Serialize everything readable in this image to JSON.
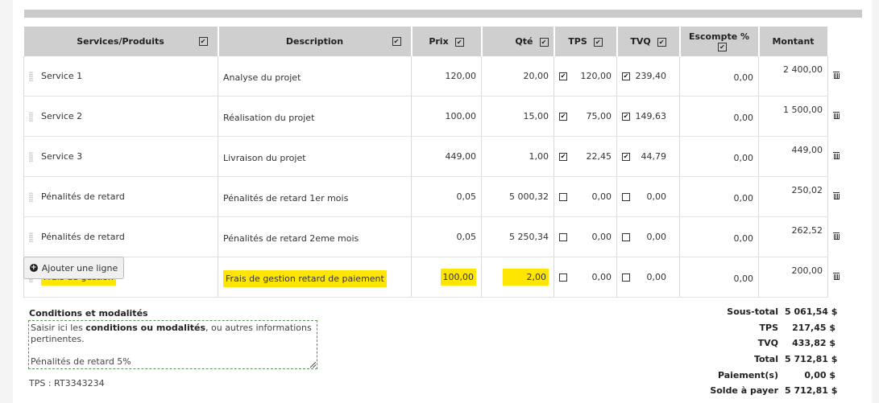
{
  "table": {
    "headers": [
      {
        "label": "Services/Produits",
        "checkbox": true
      },
      {
        "label": "Description",
        "checkbox": true
      },
      {
        "label": "Prix",
        "checkbox": true
      },
      {
        "label": "Qté",
        "checkbox": true
      },
      {
        "label": "TPS",
        "checkbox": true
      },
      {
        "label": "TVQ",
        "checkbox": true
      },
      {
        "label": "Escompte %",
        "checkbox": true
      },
      {
        "label": "Montant",
        "checkbox": false
      }
    ],
    "rows": [
      {
        "service": "Service 1",
        "description": "Analyse du projet",
        "prix": "120,00",
        "qte": "20,00",
        "tps_checked": true,
        "tps": "120,00",
        "tvq_checked": true,
        "tvq": "239,40",
        "escompte": "0,00",
        "montant": "2 400,00",
        "highlighted": false
      },
      {
        "service": "Service 2",
        "description": "Réalisation du projet",
        "prix": "100,00",
        "qte": "15,00",
        "tps_checked": true,
        "tps": "75,00",
        "tvq_checked": true,
        "tvq": "149,63",
        "escompte": "0,00",
        "montant": "1 500,00",
        "highlighted": false
      },
      {
        "service": "Service 3",
        "description": "Livraison du projet",
        "prix": "449,00",
        "qte": "1,00",
        "tps_checked": true,
        "tps": "22,45",
        "tvq_checked": true,
        "tvq": "44,79",
        "escompte": "0,00",
        "montant": "449,00",
        "highlighted": false
      },
      {
        "service": "Pénalités de retard",
        "description": "Pénalités de retard 1er mois",
        "prix": "0,05",
        "qte": "5 000,32",
        "tps_checked": false,
        "tps": "0,00",
        "tvq_checked": false,
        "tvq": "0,00",
        "escompte": "0,00",
        "montant": "250,02",
        "highlighted": false
      },
      {
        "service": "Pénalités de retard",
        "description": "Pénalités de retard 2eme mois",
        "prix": "0,05",
        "qte": "5 250,34",
        "tps_checked": false,
        "tps": "0,00",
        "tvq_checked": false,
        "tvq": "0,00",
        "escompte": "0,00",
        "montant": "262,52",
        "highlighted": false
      },
      {
        "service": "Frais de gestion",
        "description": "Frais de gestion retard de paiement",
        "prix": "100,00",
        "qte": "2,00",
        "tps_checked": false,
        "tps": "0,00",
        "tvq_checked": false,
        "tvq": "0,00",
        "escompte": "0,00",
        "montant": "200,00",
        "highlighted": true
      }
    ]
  },
  "add_line_label": "Ajouter une ligne",
  "conditions": {
    "title": "Conditions et modalités",
    "text_before": "Saisir ici les ",
    "text_bold": "conditions ou modalités",
    "text_after": ", ou autres informations pertinentes.",
    "text_line2": "Pénalités de retard 5%"
  },
  "tps_number": "TPS : RT3343234",
  "totals": [
    {
      "label": "Sous-total",
      "value": "5 061,54 $"
    },
    {
      "label": "TPS",
      "value": "217,45 $"
    },
    {
      "label": "TVQ",
      "value": "433,82 $"
    },
    {
      "label": "Total",
      "value": "5 712,81 $"
    },
    {
      "label": "Paiement(s)",
      "value": "0,00 $"
    },
    {
      "label": "Solde à payer",
      "value": "5 712,81 $"
    }
  ],
  "colors": {
    "highlight": "#ffe600",
    "header_bg": "#cfcfcf",
    "dashed_border": "#5e8f5e"
  }
}
